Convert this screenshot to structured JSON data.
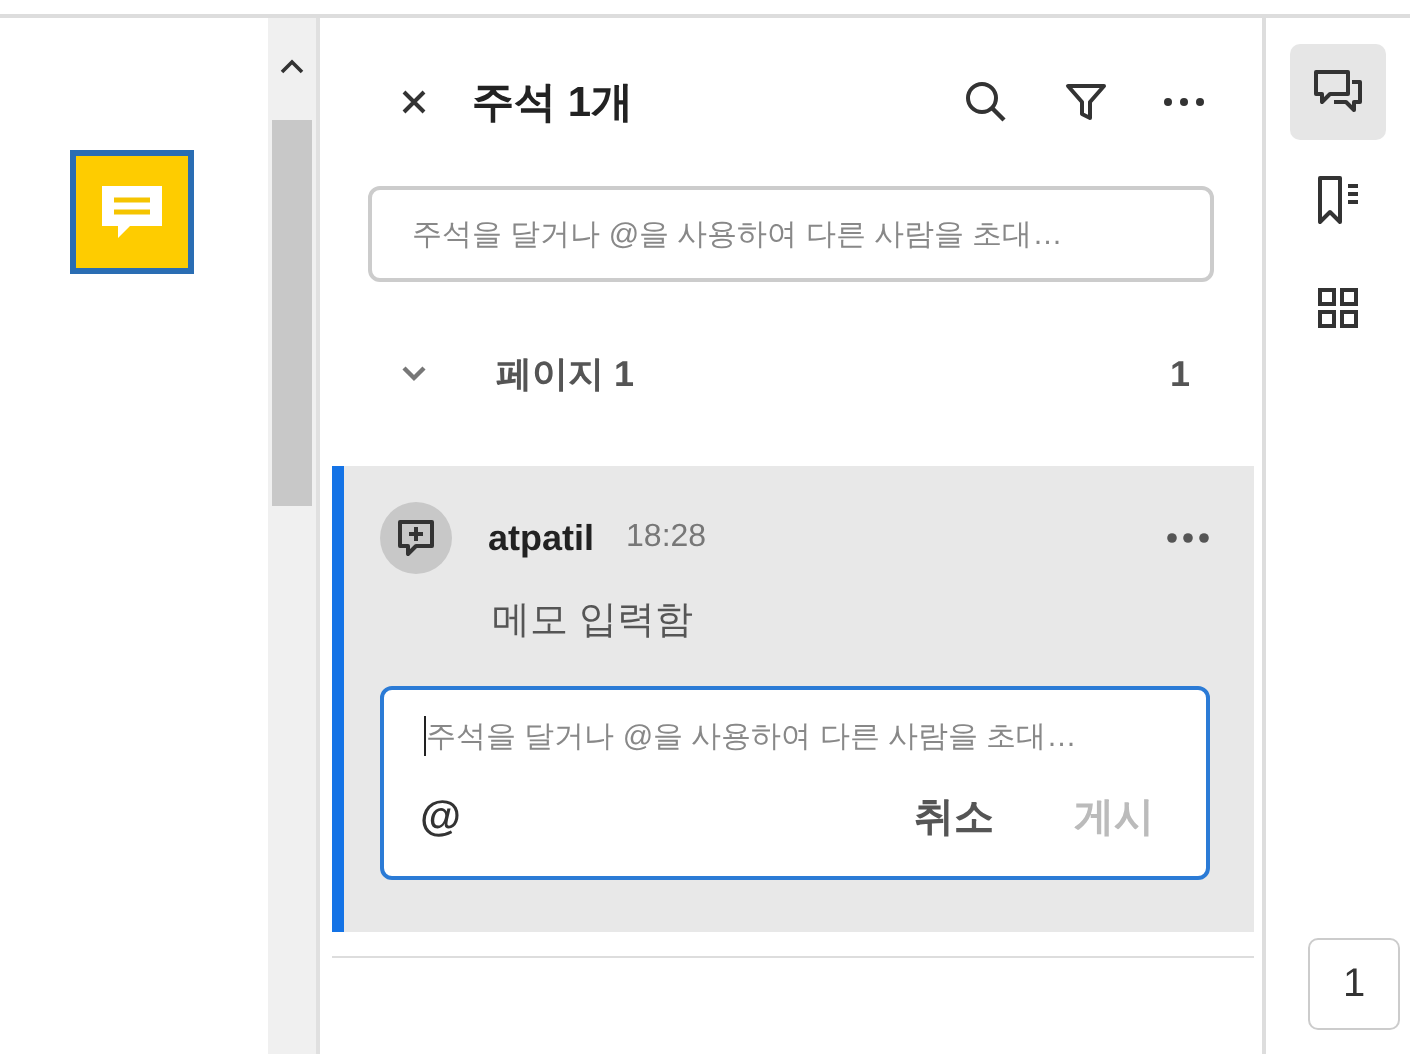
{
  "panel": {
    "title": "주석 1개",
    "search": {
      "placeholder": "주석을 달거나 @을 사용하여 다른 사람을 초대…"
    }
  },
  "page_group": {
    "label": "페이지 1",
    "count": "1",
    "expanded": true
  },
  "comment": {
    "author": "atpatil",
    "time": "18:28",
    "text": "메모 입력함",
    "selected": true,
    "reply": {
      "placeholder": "주석을 달거나 @을 사용하여 다른 사람을 초대…",
      "mention": "@",
      "buttons": [
        {
          "label": "취소",
          "kind": "cancel",
          "disabled": false
        },
        {
          "label": "게시",
          "kind": "post",
          "disabled": true
        }
      ]
    }
  },
  "rail": [
    {
      "kind": "comments",
      "selected": true
    },
    {
      "kind": "bookmarks",
      "selected": false
    },
    {
      "kind": "thumbnails",
      "selected": false
    }
  ],
  "page_number": "1"
}
